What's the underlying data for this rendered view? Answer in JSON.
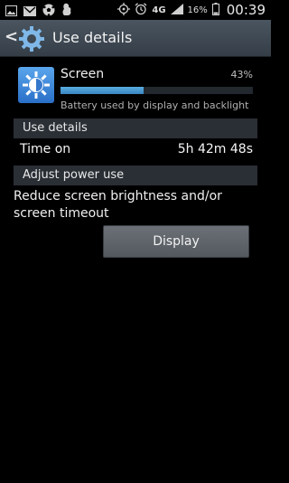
{
  "status_bar": {
    "time": "00:39",
    "battery_percent": "16%",
    "network": "4G",
    "left_icons": [
      "image-icon",
      "mail-icon",
      "soccer-ball-icon",
      "squirrel-icon"
    ],
    "right_icons": [
      "location-icon",
      "alarm-icon",
      "network-4g-icon",
      "signal-icon",
      "battery-icon"
    ]
  },
  "action_bar": {
    "title": "Use details",
    "icon": "gear-icon"
  },
  "app": {
    "name": "Screen",
    "percent": "43%",
    "usage_fraction": 0.43,
    "description": "Battery used by display and backlight",
    "bar_color": "#4a9bd6",
    "icon": "screen-brightness-icon"
  },
  "use_details": {
    "header": "Use details",
    "time_on_label": "Time on",
    "time_on_value": "5h 42m 48s"
  },
  "adjust_power": {
    "header": "Adjust power use",
    "text": "Reduce screen brightness and/or screen timeout",
    "button_label": "Display"
  }
}
